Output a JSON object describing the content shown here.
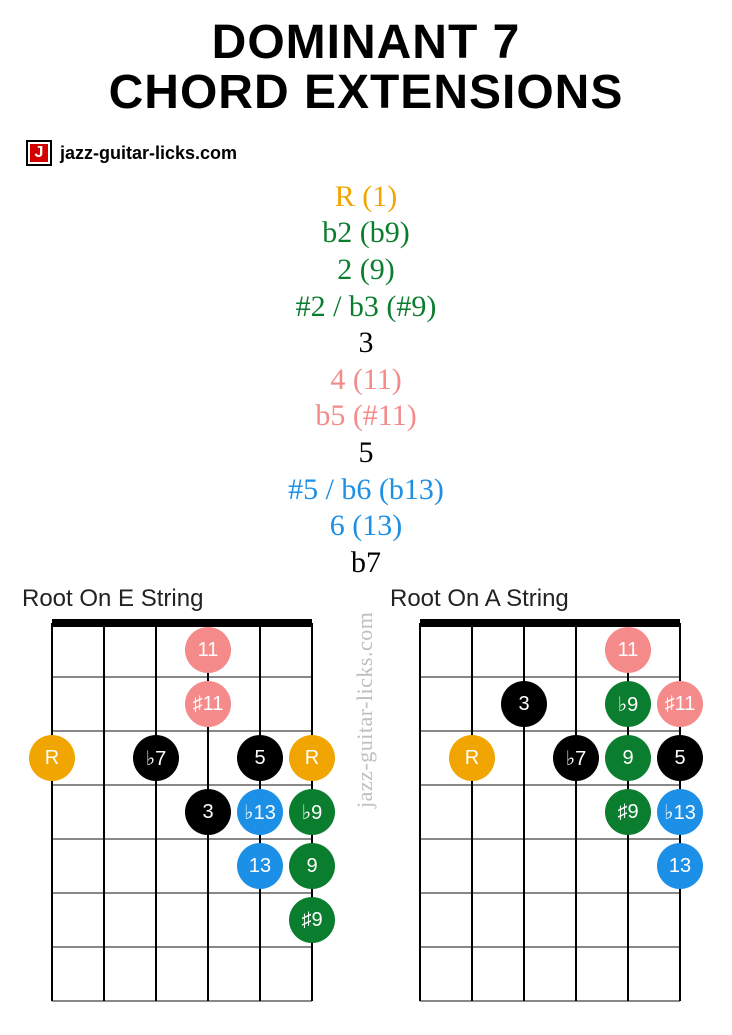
{
  "title_line1": "DOMINANT 7",
  "title_line2": "CHORD EXTENSIONS",
  "brand": {
    "badge_letter": "J",
    "site": "jazz-guitar-licks.com"
  },
  "watermark": "jazz-guitar-licks.com",
  "intervals": [
    {
      "text": "R (1)",
      "color": "c-orange"
    },
    {
      "text": "b2 (b9)",
      "color": "c-green"
    },
    {
      "text": "2 (9)",
      "color": "c-green"
    },
    {
      "text": "#2 / b3 (#9)",
      "color": "c-green"
    },
    {
      "text": "3",
      "color": "c-black"
    },
    {
      "text": "4 (11)",
      "color": "c-pink"
    },
    {
      "text": "b5 (#11)",
      "color": "c-pink"
    },
    {
      "text": "5",
      "color": "c-black"
    },
    {
      "text": "#5 / b6 (b13)",
      "color": "c-blue"
    },
    {
      "text": "6 (13)",
      "color": "c-blue"
    },
    {
      "text": "b7",
      "color": "c-black"
    }
  ],
  "chart_data": {
    "type": "table",
    "description": "Guitar fretboard note positions for dominant 7 chord extensions",
    "legend_colors": {
      "root": "#f0a500",
      "ninth_family": "#0a7d2e",
      "chord_tones": "#000000",
      "eleventh_family": "#f48a8a",
      "thirteenth_family": "#1c8fe6"
    },
    "diagrams": [
      {
        "title": "Root On E String",
        "strings": 6,
        "shown_frets": 7,
        "notes": [
          {
            "label": "11",
            "string": 4,
            "fret": 1,
            "color": "pink"
          },
          {
            "label": "♯11",
            "string": 4,
            "fret": 2,
            "color": "pink"
          },
          {
            "label": "R",
            "string": 1,
            "fret": 3,
            "color": "orange"
          },
          {
            "label": "♭7",
            "string": 3,
            "fret": 3,
            "color": "black"
          },
          {
            "label": "5",
            "string": 5,
            "fret": 3,
            "color": "black"
          },
          {
            "label": "R",
            "string": 6,
            "fret": 3,
            "color": "orange"
          },
          {
            "label": "3",
            "string": 4,
            "fret": 4,
            "color": "black"
          },
          {
            "label": "♭13",
            "string": 5,
            "fret": 4,
            "color": "blue"
          },
          {
            "label": "♭9",
            "string": 6,
            "fret": 4,
            "color": "green"
          },
          {
            "label": "13",
            "string": 5,
            "fret": 5,
            "color": "blue"
          },
          {
            "label": "9",
            "string": 6,
            "fret": 5,
            "color": "green"
          },
          {
            "label": "♯9",
            "string": 6,
            "fret": 6,
            "color": "green"
          }
        ]
      },
      {
        "title": "Root On A String",
        "strings": 6,
        "shown_frets": 7,
        "notes": [
          {
            "label": "11",
            "string": 5,
            "fret": 1,
            "color": "pink"
          },
          {
            "label": "3",
            "string": 3,
            "fret": 2,
            "color": "black"
          },
          {
            "label": "♭9",
            "string": 5,
            "fret": 2,
            "color": "green"
          },
          {
            "label": "♯11",
            "string": 6,
            "fret": 2,
            "color": "pink"
          },
          {
            "label": "R",
            "string": 2,
            "fret": 3,
            "color": "orange"
          },
          {
            "label": "♭7",
            "string": 4,
            "fret": 3,
            "color": "black"
          },
          {
            "label": "9",
            "string": 5,
            "fret": 3,
            "color": "green"
          },
          {
            "label": "5",
            "string": 6,
            "fret": 3,
            "color": "black"
          },
          {
            "label": "♯9",
            "string": 5,
            "fret": 4,
            "color": "green"
          },
          {
            "label": "♭13",
            "string": 6,
            "fret": 4,
            "color": "blue"
          },
          {
            "label": "13",
            "string": 6,
            "fret": 5,
            "color": "blue"
          }
        ]
      }
    ]
  }
}
